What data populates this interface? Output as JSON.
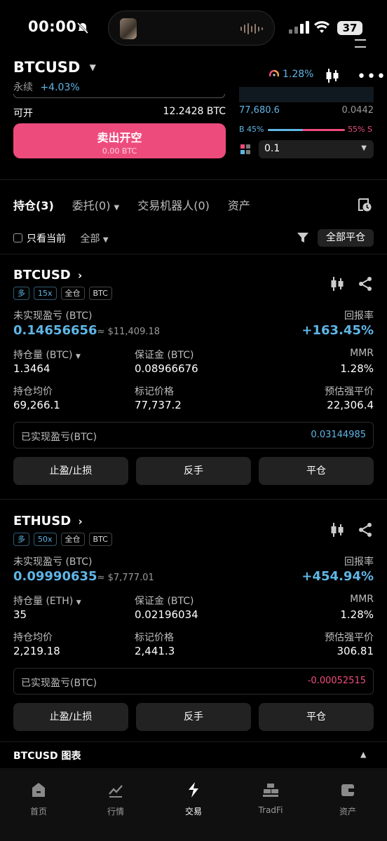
{
  "status_bar": {
    "time": "00:00",
    "battery": "37"
  },
  "header": {
    "pair": "BTCUSD",
    "type": "永续",
    "change": "+4.03%",
    "indicator_value": "1.28%"
  },
  "order_form": {
    "available_label": "可开",
    "available_value": "12.2428 BTC",
    "sell_label": "卖出开空",
    "sell_sub": "0.00 BTC"
  },
  "order_book": {
    "row_price": "77,680.6",
    "row_qty": "0.0442",
    "buy_ratio": "B 45%",
    "sell_ratio": "55% S",
    "quantity": "0.1"
  },
  "tabs": [
    {
      "label": "持仓(3)"
    },
    {
      "label": "委托(0)"
    },
    {
      "label": "交易机器人(0)"
    },
    {
      "label": "资产"
    }
  ],
  "filters": {
    "current_only": "只看当前",
    "all": "全部",
    "close_all": "全部平仓"
  },
  "positions": [
    {
      "symbol": "BTCUSD",
      "badges": [
        "多",
        "15x",
        "全仓",
        "BTC"
      ],
      "upnl_label": "未实现盈亏 (BTC)",
      "upnl_value": "0.14656656",
      "upnl_usd": "≈ $11,409.18",
      "roe_label": "回报率",
      "roe_value": "+163.45%",
      "size_label": "持仓量 (BTC)",
      "size_value": "1.3464",
      "margin_label": "保证金 (BTC)",
      "margin_value": "0.08966676",
      "mmr_label": "MMR",
      "mmr_value": "1.28%",
      "entry_label": "持仓均价",
      "entry_value": "69,266.1",
      "mark_label": "标记价格",
      "mark_value": "77,737.2",
      "liq_label": "预估强平价",
      "liq_value": "22,306.4",
      "realized_label": "已实现盈亏(BTC)",
      "realized_value": "0.03144985",
      "btn_tpsl": "止盈/止损",
      "btn_reverse": "反手",
      "btn_close": "平仓"
    },
    {
      "symbol": "ETHUSD",
      "badges": [
        "多",
        "50x",
        "全仓",
        "BTC"
      ],
      "upnl_label": "未实现盈亏 (BTC)",
      "upnl_value": "0.09990635",
      "upnl_usd": "≈ $7,777.01",
      "roe_label": "回报率",
      "roe_value": "+454.94%",
      "size_label": "持仓量 (ETH)",
      "size_value": "35",
      "margin_label": "保证金 (BTC)",
      "margin_value": "0.02196034",
      "mmr_label": "MMR",
      "mmr_value": "1.28%",
      "entry_label": "持仓均价",
      "entry_value": "2,219.18",
      "mark_label": "标记价格",
      "mark_value": "2,441.3",
      "liq_label": "预估强平价",
      "liq_value": "306.81",
      "realized_label": "已实现盈亏(BTC)",
      "realized_value": "-0.00052515",
      "btn_tpsl": "止盈/止损",
      "btn_reverse": "反手",
      "btn_close": "平仓"
    }
  ],
  "chart_section": {
    "title": "BTCUSD 图表"
  },
  "nav": [
    {
      "label": "首页",
      "icon": "home-icon"
    },
    {
      "label": "行情",
      "icon": "market-icon"
    },
    {
      "label": "交易",
      "icon": "trade-icon"
    },
    {
      "label": "TradFi",
      "icon": "tradfi-icon"
    },
    {
      "label": "资产",
      "icon": "wallet-icon"
    }
  ],
  "colors": {
    "accent": "#5fb6e6",
    "sell": "#ee4b7d",
    "liq": "#f1a64a",
    "background": "#000000"
  }
}
